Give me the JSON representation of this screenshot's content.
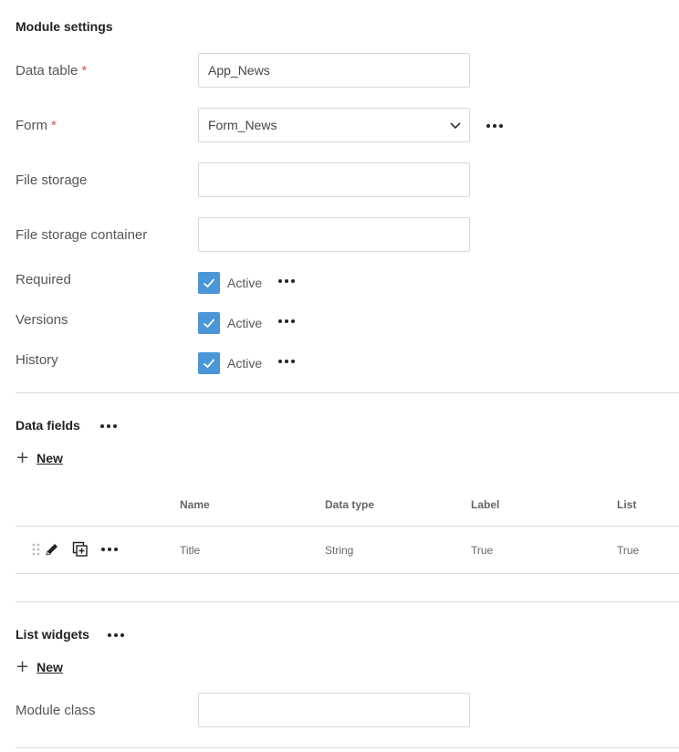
{
  "module_settings": {
    "title": "Module settings",
    "data_table": {
      "label": "Data table",
      "required_mark": "*",
      "value": "App_News"
    },
    "form": {
      "label": "Form",
      "required_mark": "*",
      "value": "Form_News"
    },
    "file_storage": {
      "label": "File storage",
      "value": ""
    },
    "file_storage_container": {
      "label": "File storage container",
      "value": ""
    },
    "required": {
      "label": "Required",
      "checkbox_label": "Active",
      "checked": true
    },
    "versions": {
      "label": "Versions",
      "checkbox_label": "Active",
      "checked": true
    },
    "history": {
      "label": "History",
      "checkbox_label": "Active",
      "checked": true
    }
  },
  "data_fields": {
    "title": "Data fields",
    "new_label": "New",
    "columns": [
      "Name",
      "Data type",
      "Label",
      "List"
    ],
    "rows": [
      {
        "name": "Title",
        "data_type": "String",
        "label": "True",
        "list": "True"
      }
    ]
  },
  "list_widgets": {
    "title": "List widgets",
    "new_label": "New",
    "module_class": {
      "label": "Module class",
      "value": ""
    }
  },
  "icons": {
    "checkbox": "checkmark-icon",
    "select": "chevron-down-icon",
    "more": "more-horizontal-icon",
    "drag": "drag-handle-icon",
    "edit": "pencil-icon",
    "duplicate": "duplicate-icon",
    "add": "plus-icon"
  },
  "colors": {
    "checkbox": "#4a96d6",
    "required": "#d9534f"
  }
}
